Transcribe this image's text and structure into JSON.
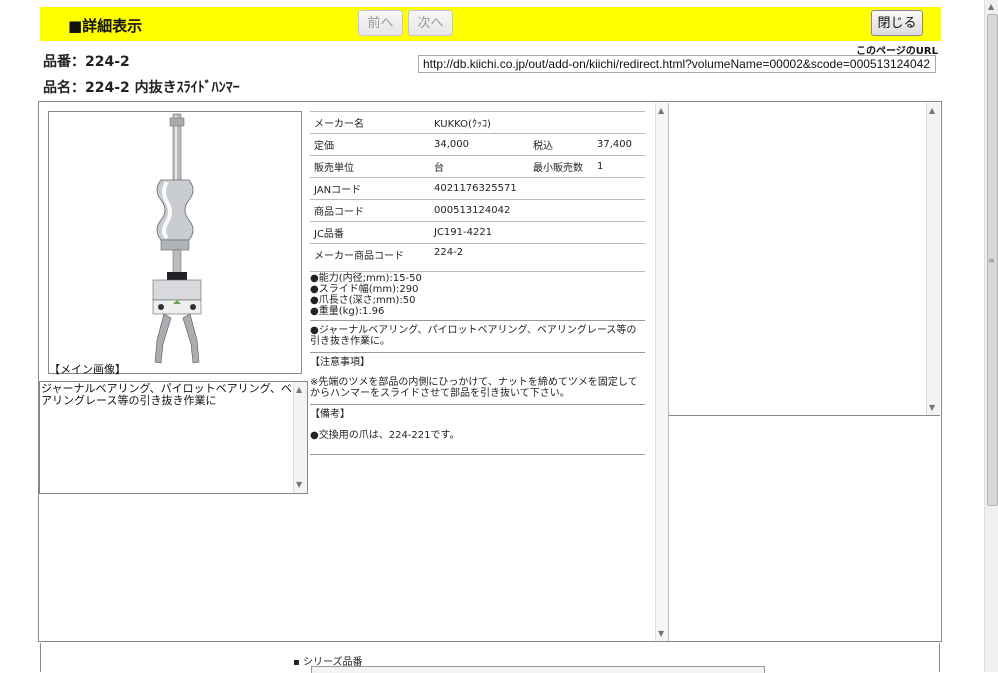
{
  "header": {
    "title": "■詳細表示",
    "prev_label": "前へ",
    "next_label": "次へ",
    "close_label": "閉じる"
  },
  "product": {
    "hinban_label": "品番：",
    "hinban_value": "224-2",
    "hinmei_label": "品名：",
    "hinmei_value": "224-2 内抜きｽﾗｲﾄﾞﾊﾝﾏｰ"
  },
  "url_section": {
    "label": "このページのURL",
    "url": "http://db.kiichi.co.jp/out/add-on/kiichi/redirect.html?volumeName=00002&scode=000513124042"
  },
  "image": {
    "caption": "【メイン画像】"
  },
  "description": "ジャーナルベアリング、パイロットベアリング、ベアリングレース等の引き抜き作業に",
  "spec_rows": [
    {
      "label": "メーカー名",
      "value": "KUKKO(ｸｯｺ)"
    },
    {
      "label": "定価",
      "value": "34,000",
      "label2": "税込",
      "value2": "37,400"
    },
    {
      "label": "販売単位",
      "value": "台",
      "label2": "最小販売数",
      "value2": "1"
    },
    {
      "label": "JANコード",
      "value": "4021176325571"
    },
    {
      "label": "商品コード",
      "value": "000513124042"
    },
    {
      "label": "JC品番",
      "value": "JC191-4221"
    },
    {
      "label": "メーカー商品コード",
      "value": "224-2"
    }
  ],
  "specs_bullets": [
    "●能力(内径;mm):15-50",
    "●スライド幅(mm):290",
    "●爪長さ(深さ;mm):50",
    "●重量(kg):1.96"
  ],
  "usage": "●ジャーナルベアリング、パイロットベアリング、ベアリングレース等の引き抜き作業に。",
  "caution": {
    "heading": "【注意事項】",
    "text": "※先端のツメを部品の内側にひっかけて、ナットを締めてツメを固定してからハンマーをスライドさせて部品を引き抜いて下さい。"
  },
  "remarks": {
    "heading": "【備考】",
    "text": "●交換用の爪は、224-221です。"
  },
  "series": {
    "label": "シリーズ品番"
  },
  "colors": {
    "header_bg": "#ffff00"
  }
}
